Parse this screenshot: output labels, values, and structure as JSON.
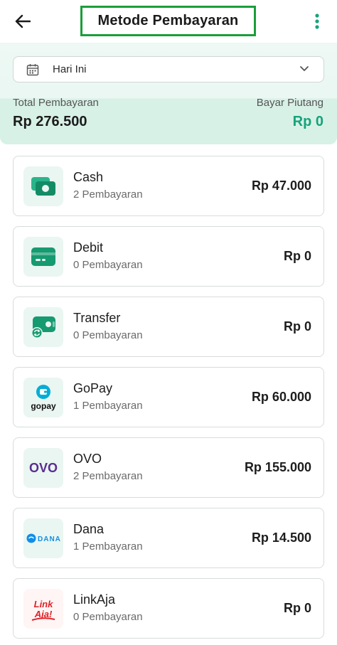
{
  "header": {
    "title": "Metode Pembayaran",
    "back_icon": "arrow-left-icon",
    "more_icon": "more-vertical-icon",
    "accent_color": "#1a9e3a"
  },
  "filter": {
    "date_label": "Hari Ini",
    "calendar_icon": "calendar-icon",
    "chevron_icon": "chevron-down-icon"
  },
  "summary": {
    "total_label": "Total Pembayaran",
    "total_value": "Rp 276.500",
    "debt_label": "Bayar Piutang",
    "debt_value": "Rp 0",
    "debt_color": "#16a37a"
  },
  "methods": [
    {
      "name": "Cash",
      "count": "2 Pembayaran",
      "amount": "Rp 47.000",
      "icon": "cash-icon"
    },
    {
      "name": "Debit",
      "count": "0 Pembayaran",
      "amount": "Rp 0",
      "icon": "debit-card-icon"
    },
    {
      "name": "Transfer",
      "count": "0 Pembayaran",
      "amount": "Rp 0",
      "icon": "transfer-icon"
    },
    {
      "name": "GoPay",
      "count": "1 Pembayaran",
      "amount": "Rp 60.000",
      "icon": "gopay-logo",
      "logo_text": "gopay"
    },
    {
      "name": "OVO",
      "count": "2 Pembayaran",
      "amount": "Rp 155.000",
      "icon": "ovo-logo",
      "logo_text": "OVO"
    },
    {
      "name": "Dana",
      "count": "1 Pembayaran",
      "amount": "Rp 14.500",
      "icon": "dana-logo",
      "logo_text": "DANA"
    },
    {
      "name": "LinkAja",
      "count": "0 Pembayaran",
      "amount": "Rp 0",
      "icon": "linkaja-logo",
      "logo_text": "LinkAja!"
    }
  ]
}
